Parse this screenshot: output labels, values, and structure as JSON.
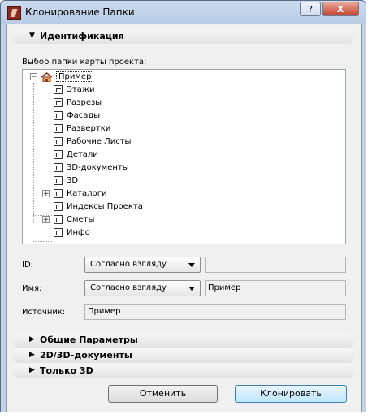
{
  "window": {
    "title": "Клонирование Папки",
    "help_label": "?",
    "close_label": "X"
  },
  "sections": {
    "identification": "Идентификация",
    "general": "Общие Параметры",
    "docs": "2D/3D-документы",
    "only3d": "Только 3D"
  },
  "folder_select_label": "Выбор папки карты проекта:",
  "tree": {
    "root": "Пример",
    "items": [
      {
        "label": "Этажи",
        "icon": "stories-icon",
        "expandable": false
      },
      {
        "label": "Разрезы",
        "icon": "sections-icon",
        "expandable": false
      },
      {
        "label": "Фасады",
        "icon": "elevations-icon",
        "expandable": false
      },
      {
        "label": "Развертки",
        "icon": "interior-elevations-icon",
        "expandable": false
      },
      {
        "label": "Рабочие Листы",
        "icon": "worksheets-icon",
        "expandable": false
      },
      {
        "label": "Детали",
        "icon": "details-icon",
        "expandable": false
      },
      {
        "label": "3D-документы",
        "icon": "3d-documents-icon",
        "expandable": false
      },
      {
        "label": "3D",
        "icon": "3d-icon",
        "expandable": false
      },
      {
        "label": "Каталоги",
        "icon": "schedules-icon",
        "expandable": true
      },
      {
        "label": "Индексы Проекта",
        "icon": "project-indexes-icon",
        "expandable": false
      },
      {
        "label": "Сметы",
        "icon": "lists-icon",
        "expandable": true
      },
      {
        "label": "Инфо",
        "icon": "info-icon",
        "expandable": false
      }
    ]
  },
  "fields": {
    "id": {
      "label": "ID:",
      "mode": "Согласно взгляду",
      "value": ""
    },
    "name": {
      "label": "Имя:",
      "mode": "Согласно взгляду",
      "value": "Пример"
    },
    "source": {
      "label": "Источник:",
      "value": "Пример"
    }
  },
  "buttons": {
    "cancel": "Отменить",
    "clone": "Клонировать"
  },
  "colors": {
    "frame": "#c3d3e6",
    "client": "#f0f0f0",
    "default_button": "#bee6fd"
  }
}
